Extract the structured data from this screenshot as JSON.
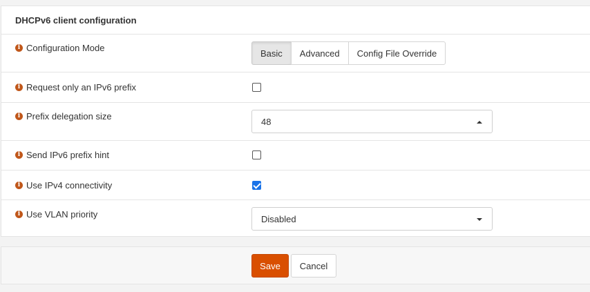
{
  "panel": {
    "title": "DHCPv6 client configuration"
  },
  "rows": {
    "config_mode": {
      "label": "Configuration Mode",
      "options": [
        "Basic",
        "Advanced",
        "Config File Override"
      ],
      "selected": "Basic"
    },
    "request_prefix": {
      "label": "Request only an IPv6 prefix",
      "checked": false
    },
    "prefix_delegation": {
      "label": "Prefix delegation size",
      "value": "48"
    },
    "send_prefix_hint": {
      "label": "Send IPv6 prefix hint",
      "checked": false
    },
    "use_ipv4": {
      "label": "Use IPv4 connectivity",
      "checked": true
    },
    "vlan_priority": {
      "label": "Use VLAN priority",
      "value": "Disabled"
    }
  },
  "footer": {
    "save_label": "Save",
    "cancel_label": "Cancel"
  },
  "icons": {
    "info": "info-circle-icon",
    "info_glyph": "i",
    "select_caret_open": "caret-up-icon",
    "select_caret_closed": "caret-down-icon"
  },
  "colors": {
    "accent": "#d94f00",
    "info_icon": "#c0571a",
    "checkbox_checked": "#1a73e8"
  }
}
